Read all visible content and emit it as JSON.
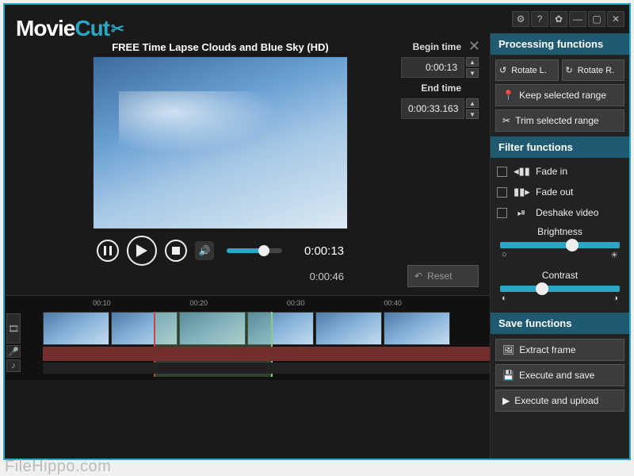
{
  "logo": {
    "part1": "Movie",
    "part2": "Cut"
  },
  "titlebar_icons": [
    "bulb-icon",
    "help-icon",
    "gear-icon",
    "minimize-icon",
    "maximize-icon",
    "close-icon"
  ],
  "clip": {
    "title": "FREE Time Lapse Clouds and Blue Sky (HD)",
    "begin_label": "Begin time",
    "begin_value": "0:00:13",
    "end_label": "End time",
    "end_value": "0:00:33.163",
    "reset_label": "Reset"
  },
  "playback": {
    "current": "0:00:13",
    "total": "0:00:46",
    "progress_pct": 75
  },
  "ruler": [
    {
      "label": "00:10",
      "pos_pct": 20
    },
    {
      "label": "00:20",
      "pos_pct": 40
    },
    {
      "label": "00:30",
      "pos_pct": 60
    },
    {
      "label": "00:40",
      "pos_pct": 80
    }
  ],
  "panels": {
    "processing": {
      "title": "Processing functions",
      "rotate_l": "Rotate L.",
      "rotate_r": "Rotate R.",
      "keep": "Keep selected range",
      "trim": "Trim selected range"
    },
    "filter": {
      "title": "Filter functions",
      "fade_in": "Fade in",
      "fade_out": "Fade out",
      "deshake": "Deshake video",
      "brightness": "Brightness",
      "contrast": "Contrast",
      "brightness_pct": 55,
      "contrast_pct": 30
    },
    "save": {
      "title": "Save functions",
      "extract": "Extract frame",
      "execute_save": "Execute and save",
      "execute_upload": "Execute and upload"
    }
  },
  "watermark": "FileHippo.com",
  "colors": {
    "accent": "#2aa6c4",
    "panel_header": "#1f5a70"
  }
}
